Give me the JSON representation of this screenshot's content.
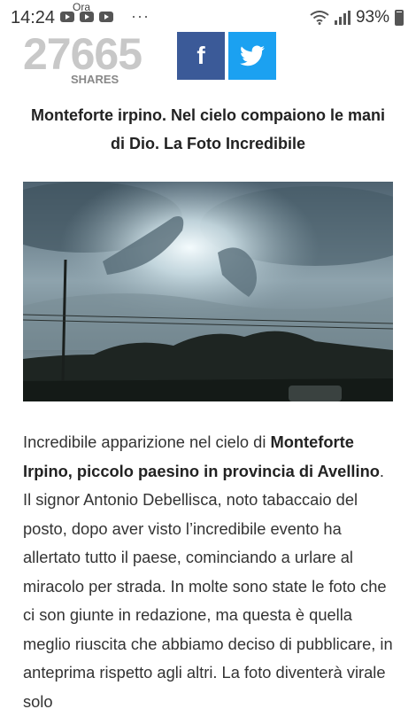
{
  "status_bar": {
    "time": "14:24",
    "notification_label": "Ora",
    "more_indicator": "···",
    "battery_percent": "93%",
    "icons": [
      "youtube-icon",
      "youtube-icon",
      "youtube-icon",
      "wifi-icon",
      "signal-icon",
      "battery-icon"
    ]
  },
  "share": {
    "count": "27665",
    "label": "SHARES",
    "facebook_glyph": "f",
    "twitter_icon": "twitter-bird-icon",
    "facebook_color": "#3b5a98",
    "twitter_color": "#1ba1f1"
  },
  "article": {
    "title": "Monteforte irpino. Nel cielo compaiono le mani di Dio. La Foto Incredibile",
    "image_alt_icon": "photo",
    "body": {
      "p1": "Incredibile apparizione nel cielo di ",
      "b1": "Monteforte Irpino, piccolo paesino in provincia di Avellino",
      "p2": ". Il signor Antonio Debellisca, noto tabaccaio del posto, dopo aver visto l’incredibile evento ha allertato tutto il paese, cominciando a urlare al miracolo per strada. In molte sono state le foto che ci son giunte in redazione, ma questa è quella meglio riuscita che abbiamo deciso di pubblicare, in anteprima rispetto agli altri. La foto diventerà virale solo"
    }
  }
}
